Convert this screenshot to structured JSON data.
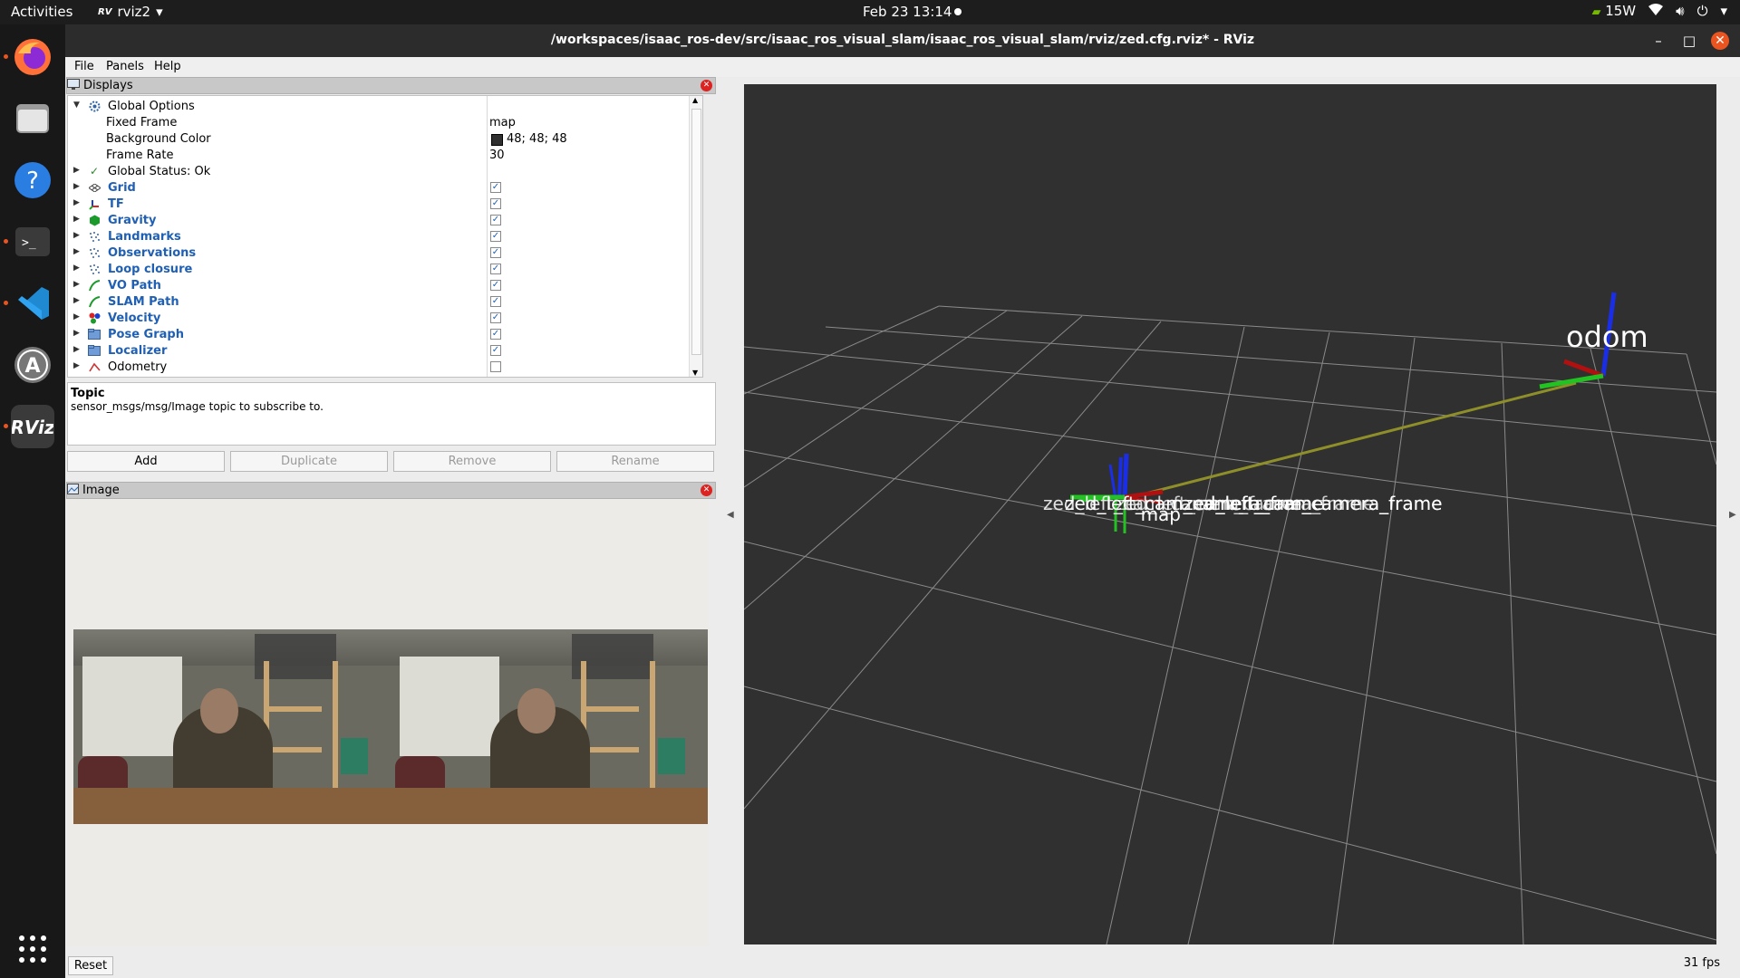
{
  "system_bar": {
    "activities": "Activities",
    "app_name": "rviz2",
    "datetime": "Feb 23  13:14",
    "power": "15W"
  },
  "window": {
    "title": "/workspaces/isaac_ros-dev/src/isaac_ros_visual_slam/isaac_ros_visual_slam/rviz/zed.cfg.rviz* - RViz",
    "minimize": "–",
    "maximize": "□",
    "close": "✕"
  },
  "menu": {
    "file": "File",
    "panels": "Panels",
    "help": "Help"
  },
  "displays_panel": {
    "title": "Displays",
    "global_options": {
      "label": "Global Options",
      "fixed_frame_label": "Fixed Frame",
      "fixed_frame_value": "map",
      "background_color_label": "Background Color",
      "background_color_value": "48; 48; 48",
      "background_color_swatch": "#303030",
      "frame_rate_label": "Frame Rate",
      "frame_rate_value": "30"
    },
    "global_status": "Global Status: Ok",
    "items": [
      {
        "label": "Grid",
        "checked": true,
        "icon": "grid-icon"
      },
      {
        "label": "TF",
        "checked": true,
        "icon": "tf-icon"
      },
      {
        "label": "Gravity",
        "checked": true,
        "icon": "marker-icon"
      },
      {
        "label": "Landmarks",
        "checked": true,
        "icon": "pointcloud-icon"
      },
      {
        "label": "Observations",
        "checked": true,
        "icon": "pointcloud-icon"
      },
      {
        "label": "Loop closure",
        "checked": true,
        "icon": "pointcloud-icon"
      },
      {
        "label": "VO Path",
        "checked": true,
        "icon": "path-icon"
      },
      {
        "label": "SLAM Path",
        "checked": true,
        "icon": "path-icon"
      },
      {
        "label": "Velocity",
        "checked": true,
        "icon": "marker-array-icon"
      },
      {
        "label": "Pose Graph",
        "checked": true,
        "icon": "folder-icon"
      },
      {
        "label": "Localizer",
        "checked": true,
        "icon": "folder-icon"
      },
      {
        "label": "Odometry",
        "checked": false,
        "icon": "odometry-icon"
      }
    ]
  },
  "description": {
    "title": "Topic",
    "text": "sensor_msgs/msg/Image topic to subscribe to."
  },
  "buttons": {
    "add": "Add",
    "duplicate": "Duplicate",
    "remove": "Remove",
    "rename": "Rename",
    "reset": "Reset"
  },
  "image_panel": {
    "title": "Image"
  },
  "view3d": {
    "frame_labels": {
      "odom": "odom",
      "map": "map",
      "overlap": "zed_left_cam_camera_frame"
    },
    "fps": "31 fps"
  },
  "colors": {
    "accent_blue": "#1f5fb4",
    "viewport_bg": "#303030",
    "ubuntu_orange": "#e95420"
  }
}
